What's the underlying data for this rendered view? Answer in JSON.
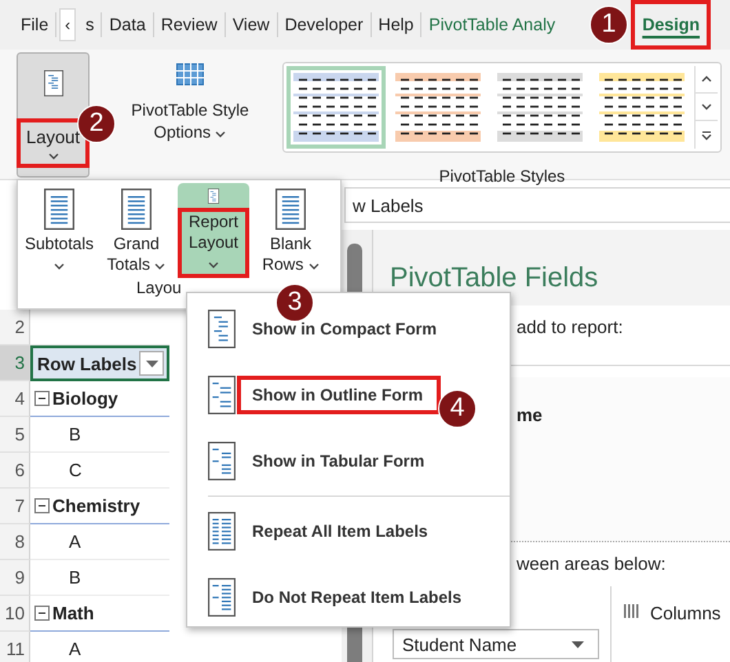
{
  "ribbon_tabs": [
    {
      "label": "File",
      "kind": "normal",
      "selected": false,
      "highlighted": false
    },
    {
      "label": "‹",
      "kind": "scroll",
      "selected": false,
      "highlighted": false
    },
    {
      "label": "s",
      "kind": "normal",
      "selected": false,
      "highlighted": false
    },
    {
      "label": "Data",
      "kind": "normal",
      "selected": false,
      "highlighted": false
    },
    {
      "label": "Review",
      "kind": "normal",
      "selected": false,
      "highlighted": false
    },
    {
      "label": "View",
      "kind": "normal",
      "selected": false,
      "highlighted": false
    },
    {
      "label": "Developer",
      "kind": "normal",
      "selected": false,
      "highlighted": false
    },
    {
      "label": "Help",
      "kind": "normal",
      "selected": false,
      "highlighted": false
    },
    {
      "label": "PivotTable Analy",
      "kind": "context",
      "selected": false,
      "highlighted": false
    },
    {
      "label": "Design",
      "kind": "context",
      "selected": true,
      "highlighted": true
    }
  ],
  "ribbon": {
    "layout_button": {
      "label": "Layout",
      "pressed": true,
      "highlighted": true
    },
    "style_options_button": {
      "label": "PivotTable Style Options"
    },
    "styles_gallery": {
      "label": "PivotTable Styles",
      "styles": [
        {
          "color": "#c9d6ee",
          "selected": true
        },
        {
          "color": "#f8cbad",
          "selected": false
        },
        {
          "color": "#dcdcdc",
          "selected": false
        },
        {
          "color": "#ffe699",
          "selected": false
        }
      ]
    }
  },
  "layout_panel": {
    "buttons": [
      {
        "label": "Subtotals",
        "selected": false,
        "highlighted": false
      },
      {
        "label": "Grand Totals",
        "selected": false,
        "highlighted": false
      },
      {
        "label": "Report Layout",
        "selected": true,
        "highlighted": true
      },
      {
        "label": "Blank Rows",
        "selected": false,
        "highlighted": false
      }
    ],
    "group_label": "Layou"
  },
  "report_layout_menu": {
    "items": [
      {
        "label": "Show in Compact Form",
        "kind": "compact",
        "highlighted": false
      },
      {
        "label": "Show in Outline Form",
        "kind": "outline",
        "highlighted": true
      },
      {
        "label": "Show in Tabular Form",
        "kind": "tabular",
        "highlighted": false
      },
      {
        "label": "Repeat All Item Labels",
        "kind": "repeat",
        "highlighted": false
      },
      {
        "label": "Do Not Repeat Item Labels",
        "kind": "norepeat",
        "highlighted": false
      }
    ]
  },
  "sheet": {
    "formula_text": "w Labels",
    "rows": [
      {
        "number": "2",
        "kind": "empty",
        "selected": false
      },
      {
        "number": "3",
        "text": "Row Labels",
        "kind": "header",
        "selected": true
      },
      {
        "number": "4",
        "text": "Biology",
        "kind": "group",
        "expanded": true,
        "selected": false
      },
      {
        "number": "5",
        "text": "B",
        "kind": "item",
        "selected": false
      },
      {
        "number": "6",
        "text": "C",
        "kind": "item",
        "selected": false
      },
      {
        "number": "7",
        "text": "Chemistry",
        "kind": "group",
        "expanded": true,
        "selected": false
      },
      {
        "number": "8",
        "text": "A",
        "kind": "item",
        "selected": false
      },
      {
        "number": "9",
        "text": "B",
        "kind": "item",
        "selected": false
      },
      {
        "number": "10",
        "text": "Math",
        "kind": "group",
        "expanded": true,
        "selected": false
      },
      {
        "number": "11",
        "text": "A",
        "kind": "item",
        "selected": false
      }
    ]
  },
  "fields_pane": {
    "title": "PivotTable Fields",
    "prompt": "add to report:",
    "field": "me",
    "areas_hint": "ween areas below:",
    "columns_label": "Columns",
    "rows_field": "Student Name"
  },
  "callouts": [
    {
      "label": "1"
    },
    {
      "label": "2"
    },
    {
      "label": "3"
    },
    {
      "label": "4"
    }
  ]
}
